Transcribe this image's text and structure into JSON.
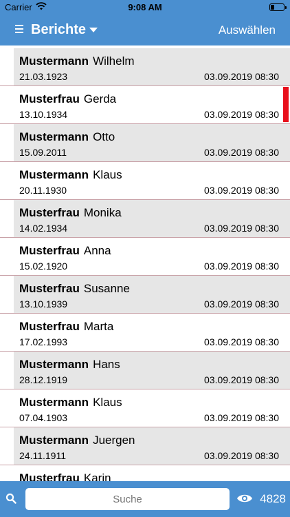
{
  "status": {
    "carrier": "Carrier",
    "time": "9:08 AM"
  },
  "navbar": {
    "title": "Berichte",
    "select_label": "Auswählen"
  },
  "list": {
    "items": [
      {
        "last": "Mustermann",
        "first": "Wilhelm",
        "birth": "21.03.1923",
        "stamp": "03.09.2019 08:30",
        "shaded": true,
        "flag": false
      },
      {
        "last": "Musterfrau",
        "first": "Gerda",
        "birth": "13.10.1934",
        "stamp": "03.09.2019 08:30",
        "shaded": false,
        "flag": true
      },
      {
        "last": "Mustermann",
        "first": "Otto",
        "birth": "15.09.2011",
        "stamp": "03.09.2019 08:30",
        "shaded": true,
        "flag": false
      },
      {
        "last": "Mustermann",
        "first": "Klaus",
        "birth": "20.11.1930",
        "stamp": "03.09.2019 08:30",
        "shaded": false,
        "flag": false
      },
      {
        "last": "Musterfrau",
        "first": "Monika",
        "birth": "14.02.1934",
        "stamp": "03.09.2019 08:30",
        "shaded": true,
        "flag": false
      },
      {
        "last": "Musterfrau",
        "first": "Anna",
        "birth": "15.02.1920",
        "stamp": "03.09.2019 08:30",
        "shaded": false,
        "flag": false
      },
      {
        "last": "Musterfrau",
        "first": "Susanne",
        "birth": "13.10.1939",
        "stamp": "03.09.2019 08:30",
        "shaded": true,
        "flag": false
      },
      {
        "last": "Musterfrau",
        "first": "Marta",
        "birth": "17.02.1993",
        "stamp": "03.09.2019 08:30",
        "shaded": false,
        "flag": false
      },
      {
        "last": "Mustermann",
        "first": "Hans",
        "birth": "28.12.1919",
        "stamp": "03.09.2019 08:30",
        "shaded": true,
        "flag": false
      },
      {
        "last": "Mustermann",
        "first": "Klaus",
        "birth": "07.04.1903",
        "stamp": "03.09.2019 08:30",
        "shaded": false,
        "flag": false
      },
      {
        "last": "Mustermann",
        "first": "Juergen",
        "birth": "24.11.1911",
        "stamp": "03.09.2019 08:30",
        "shaded": true,
        "flag": false
      },
      {
        "last": "Musterfrau",
        "first": "Karin",
        "birth": "",
        "stamp": "",
        "shaded": false,
        "flag": false
      }
    ]
  },
  "bottombar": {
    "search_placeholder": "Suche",
    "count": "4828"
  },
  "colors": {
    "bar": "#4a8fd0",
    "row_shaded": "#e6e6e6",
    "flag": "#e8101c"
  }
}
